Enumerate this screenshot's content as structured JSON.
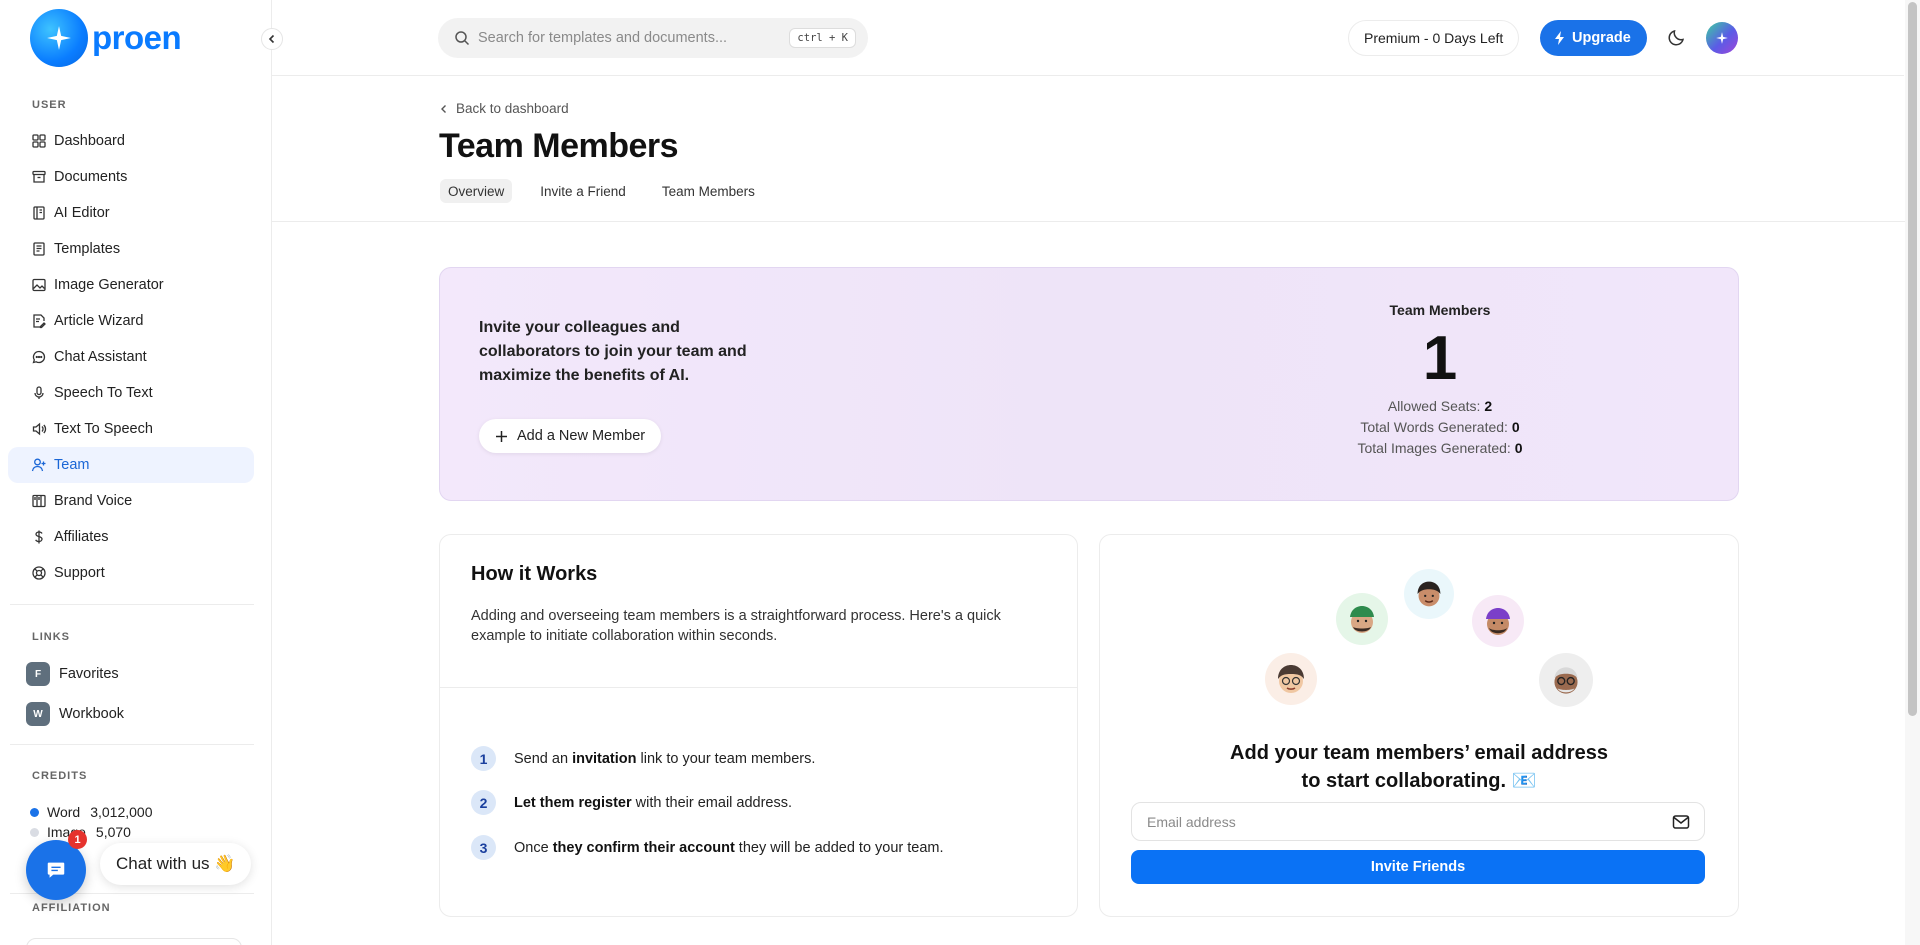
{
  "brand": {
    "name": "proen"
  },
  "sidebar": {
    "user_label": "USER",
    "items": [
      {
        "label": "Dashboard",
        "icon": "grid-icon"
      },
      {
        "label": "Documents",
        "icon": "archive-icon"
      },
      {
        "label": "AI Editor",
        "icon": "notebook-icon"
      },
      {
        "label": "Templates",
        "icon": "file-text-icon"
      },
      {
        "label": "Image Generator",
        "icon": "image-icon"
      },
      {
        "label": "Article Wizard",
        "icon": "file-edit-icon"
      },
      {
        "label": "Chat Assistant",
        "icon": "chat-icon"
      },
      {
        "label": "Speech To Text",
        "icon": "microphone-icon"
      },
      {
        "label": "Text To Speech",
        "icon": "speaker-icon"
      },
      {
        "label": "Team",
        "icon": "user-plus-icon",
        "active": true
      },
      {
        "label": "Brand Voice",
        "icon": "columns-icon"
      },
      {
        "label": "Affiliates",
        "icon": "dollar-icon"
      },
      {
        "label": "Support",
        "icon": "lifebuoy-icon"
      }
    ],
    "links_label": "LINKS",
    "links": [
      {
        "badge": "F",
        "label": "Favorites"
      },
      {
        "badge": "W",
        "label": "Workbook"
      }
    ],
    "credits_label": "CREDITS",
    "credits": [
      {
        "name": "Word",
        "value": "3,012,000",
        "color": "#1a72e8"
      },
      {
        "name": "Image",
        "value": "5,070",
        "color": "#d9dce3"
      }
    ],
    "affiliation_label": "AFFILIATION"
  },
  "chat": {
    "label": "Chat with us 👋",
    "badge": "1"
  },
  "topbar": {
    "search_placeholder": "Search for templates and documents...",
    "shortcut": "ctrl + K",
    "plan": "Premium - 0 Days Left",
    "upgrade": "Upgrade"
  },
  "header": {
    "back": "Back to dashboard",
    "title": "Team Members",
    "tabs": [
      "Overview",
      "Invite a Friend",
      "Team Members"
    ]
  },
  "hero": {
    "text": "Invite your colleagues and collaborators to join your team and maximize the benefits of AI.",
    "add_button": "Add a New Member",
    "stats_label": "Team Members",
    "count": "1",
    "rows": [
      {
        "label": "Allowed Seats:",
        "value": "2"
      },
      {
        "label": "Total Words Generated:",
        "value": "0"
      },
      {
        "label": "Total Images Generated:",
        "value": "0"
      }
    ]
  },
  "how": {
    "title": "How it Works",
    "description": "Adding and overseeing team members is a straightforward process. Here's a quick example to initiate collaboration within seconds.",
    "steps": [
      {
        "n": "1",
        "pre": "Send an ",
        "bold": "invitation",
        "post": " link to your team members."
      },
      {
        "n": "2",
        "pre": "",
        "bold": "Let them register",
        "post": " with their email address."
      },
      {
        "n": "3",
        "pre": "Once ",
        "bold": "they confirm their account",
        "post": " they will be added to your team."
      }
    ]
  },
  "invite": {
    "heading_line1": "Add your team members’ email address",
    "heading_line2": "to start collaborating. 📧",
    "email_placeholder": "Email address",
    "button": "Invite Friends"
  },
  "colors": {
    "accent": "#1a72e8",
    "hero_bg": "#f1e6fa",
    "active_nav_bg": "#eef3ff"
  }
}
